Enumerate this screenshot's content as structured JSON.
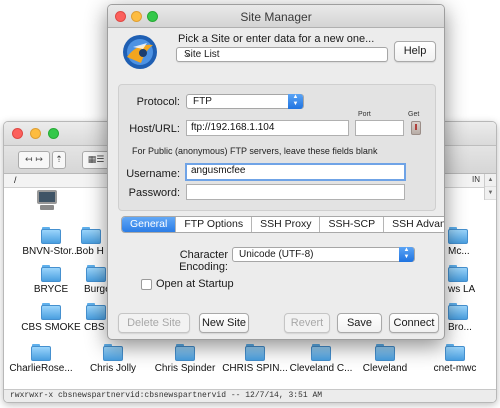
{
  "background_window": {
    "toolbar": {
      "nav_label": "↤ ↦",
      "up_label": "⇡"
    },
    "path": "/",
    "path_right": "IN",
    "files_row1": [
      "BNVN-Stor...",
      "Bob H",
      "Mc..."
    ],
    "files_row2": [
      "BRYCE",
      "Burge",
      "ws LA"
    ],
    "files_row3": [
      "CBS SMOKE",
      "CBS S",
      "Bro..."
    ],
    "files_row4": [
      "CharlieRose...",
      "Chris Jolly",
      "Chris Spinder",
      "CHRIS SPIN...",
      "Cleveland C...",
      "Cleveland",
      "cnet-mwc"
    ],
    "status": "rwxrwxr-x  cbsnewspartnervid:cbsnewspartnervid  --  12/7/14, 3:51 AM"
  },
  "site_manager": {
    "title": "Site Manager",
    "prompt": "Pick a Site or enter data for a new one...",
    "site_list": {
      "value": "Site List"
    },
    "help_label": "Help",
    "protocol": {
      "label": "Protocol:",
      "value": "FTP"
    },
    "host": {
      "label": "Host/URL:",
      "value": "ftp://192.168.1.104"
    },
    "port": {
      "label": "Port",
      "value": ""
    },
    "get_label": "Get",
    "anon_note": "For Public (anonymous) FTP servers, leave these fields blank",
    "username": {
      "label": "Username:",
      "value": "angusmcfee"
    },
    "password": {
      "label": "Password:",
      "value": ""
    },
    "tabs": [
      {
        "label": "General",
        "active": true
      },
      {
        "label": "FTP Options",
        "active": false
      },
      {
        "label": "SSH Proxy",
        "active": false
      },
      {
        "label": "SSH-SCP",
        "active": false
      },
      {
        "label": "SSH Advanced",
        "active": false
      }
    ],
    "encoding": {
      "label": "Character Encoding:",
      "value": "Unicode (UTF-8)"
    },
    "open_at_startup": {
      "label": "Open at Startup",
      "checked": false
    },
    "buttons": {
      "delete_site": "Delete Site",
      "new_site": "New Site",
      "revert": "Revert",
      "save": "Save",
      "connect": "Connect"
    },
    "colors": {
      "accent": "#2b7de6",
      "focus_ring": "#6fa3e6"
    }
  }
}
